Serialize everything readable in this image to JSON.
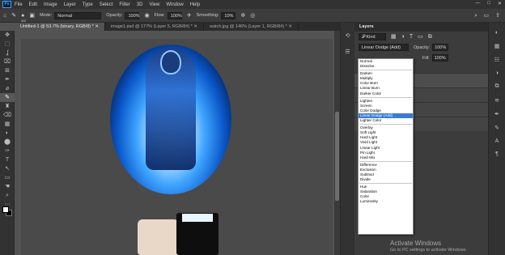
{
  "menubar": {
    "logo": "Ps",
    "items": [
      "File",
      "Edit",
      "Image",
      "Layer",
      "Type",
      "Select",
      "Filter",
      "3D",
      "View",
      "Window",
      "Help"
    ],
    "window_controls": [
      "—",
      "□",
      "✕"
    ]
  },
  "options": {
    "brush_size": "300",
    "mode_label": "Mode:",
    "mode_value": "Normal",
    "opacity_label": "Opacity:",
    "opacity_value": "100%",
    "flow_label": "Flow:",
    "flow_value": "100%",
    "smoothing_label": "Smoothing:",
    "smoothing_value": "10%"
  },
  "tabs": [
    {
      "label": "Untitled-1 @ 53.7% (binary, RGB/8) *",
      "active": true
    },
    {
      "label": "image1.psd @ 177% (Layer 5, RGB/8#) *",
      "active": false
    },
    {
      "label": "watch.jpg @ 146% (Layer 1, RGB/8#) *",
      "active": false
    }
  ],
  "tools": [
    "✥",
    "⬚",
    "ʆ",
    "⌧",
    "⊞",
    "✒",
    "⌀",
    "✎",
    "♜",
    "⌫",
    "▦",
    "◐",
    "⬤",
    "✑",
    "T",
    "↖",
    "▭",
    "☚",
    "⌕",
    "⋯"
  ],
  "layers_panel": {
    "title": "Layers",
    "kind_label": "𝒫 Kind",
    "blend_mode": "Linear Dodge (Add)",
    "opacity_label": "Opacity:",
    "opacity_value": "100%",
    "fill_label": "Fill:",
    "fill_value": "100%"
  },
  "blend_modes": {
    "groups": [
      [
        "Normal",
        "Dissolve"
      ],
      [
        "Darken",
        "Multiply",
        "Color Burn",
        "Linear Burn",
        "Darker Color"
      ],
      [
        "Lighten",
        "Screen",
        "Color Dodge",
        "Linear Dodge (Add)",
        "Lighter Color"
      ],
      [
        "Overlay",
        "Soft Light",
        "Hard Light",
        "Vivid Light",
        "Linear Light",
        "Pin Light",
        "Hard Mix"
      ],
      [
        "Difference",
        "Exclusion",
        "Subtract",
        "Divide"
      ],
      [
        "Hue",
        "Saturation",
        "Color",
        "Luminosity"
      ]
    ],
    "selected": "Linear Dodge (Add)"
  },
  "watermark": {
    "title": "Activate Windows",
    "subtitle": "Go to PC settings to activate Windows."
  },
  "colors": {
    "accent": "#3a7bd5",
    "ps_blue": "#31a8ff"
  }
}
